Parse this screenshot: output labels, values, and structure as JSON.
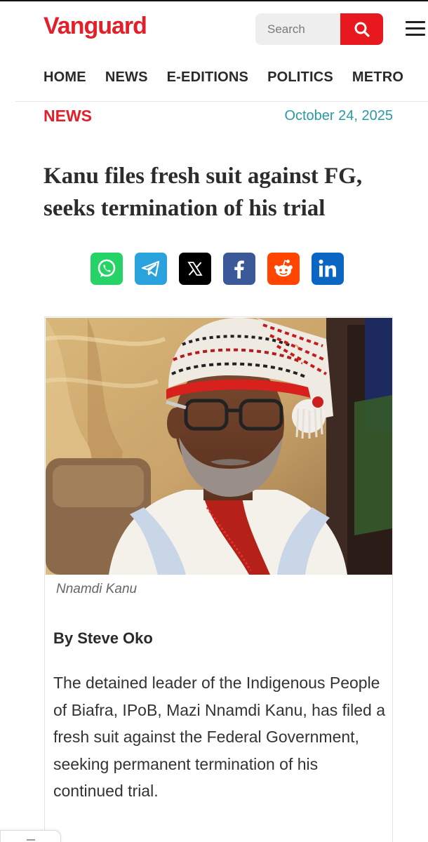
{
  "header": {
    "logo": "Vanguard",
    "search_placeholder": "Search"
  },
  "nav": {
    "items": [
      "HOME",
      "NEWS",
      "E-EDITIONS",
      "POLITICS",
      "METRO"
    ]
  },
  "article": {
    "section": "NEWS",
    "date": "October 24, 2025",
    "headline": "Kanu files fresh suit against FG, seeks termination of his trial",
    "image_caption": "Nnamdi Kanu",
    "byline": "By Steve Oko",
    "paragraph": "The detained leader of the Indigenous People of Biafra, IPoB, Mazi Nnamdi Kanu, has filed a fresh suit against the Federal Government, seeking permanent termination of his continued trial."
  },
  "share": [
    {
      "name": "whatsapp-icon",
      "color": "#25d366"
    },
    {
      "name": "telegram-icon",
      "color": "#2aa3dc"
    },
    {
      "name": "x-icon",
      "color": "#000000"
    },
    {
      "name": "facebook-icon",
      "color": "#3b5998"
    },
    {
      "name": "reddit-icon",
      "color": "#ff4500"
    },
    {
      "name": "linkedin-icon",
      "color": "#0a66c2"
    }
  ],
  "colors": {
    "brand_red": "#e2202a",
    "date_teal": "#2b9aa5"
  }
}
